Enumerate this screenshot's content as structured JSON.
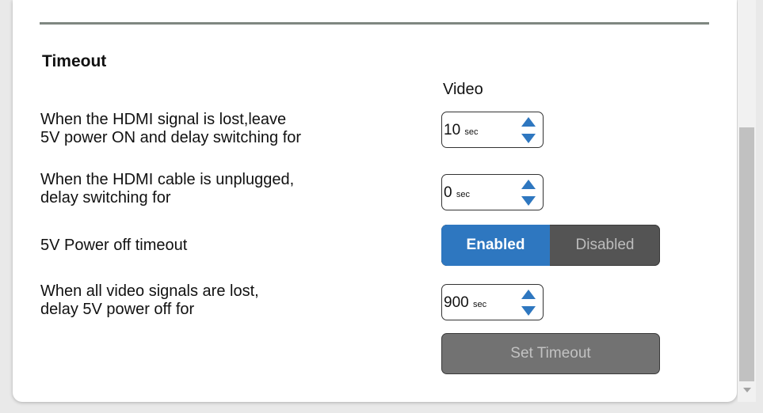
{
  "section": {
    "title": "Timeout",
    "column_header": "Video"
  },
  "rows": [
    {
      "label_lines": [
        "When the HDMI signal is lost,leave",
        "5V power ON and delay switching for"
      ],
      "value": "10",
      "unit": "sec"
    },
    {
      "label_lines": [
        "When the HDMI cable is unplugged,",
        "delay switching for"
      ],
      "value": "0",
      "unit": "sec"
    },
    {
      "label_lines": [
        "When all video signals are lost,",
        "delay 5V power off for"
      ],
      "value": "900",
      "unit": "sec"
    }
  ],
  "power_off": {
    "label": "5V Power off timeout",
    "enabled_label": "Enabled",
    "disabled_label": "Disabled",
    "selected": "Enabled"
  },
  "set_button_label": "Set Timeout",
  "colors": {
    "accent": "#2e77c0",
    "divider": "#7f8781",
    "toggle_bg": "#545454",
    "button_bg": "#727272"
  },
  "icons": {
    "spin_up": "triangle-up-icon",
    "spin_down": "triangle-down-icon",
    "scroll_down": "scroll-down-arrow-icon"
  }
}
